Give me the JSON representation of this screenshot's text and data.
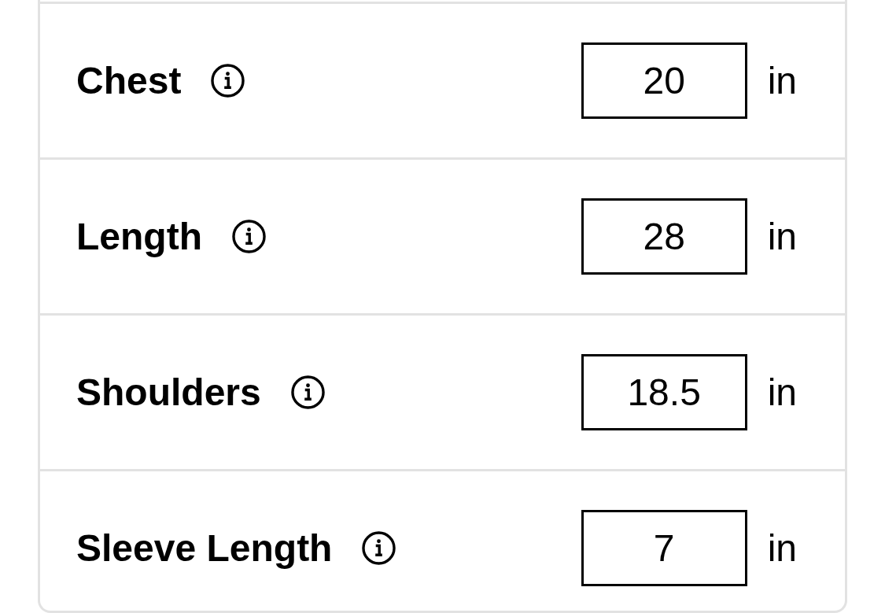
{
  "measurements": [
    {
      "label": "Chest",
      "value": "20",
      "unit": "in"
    },
    {
      "label": "Length",
      "value": "28",
      "unit": "in"
    },
    {
      "label": "Shoulders",
      "value": "18.5",
      "unit": "in"
    },
    {
      "label": "Sleeve Length",
      "value": "7",
      "unit": "in"
    }
  ]
}
